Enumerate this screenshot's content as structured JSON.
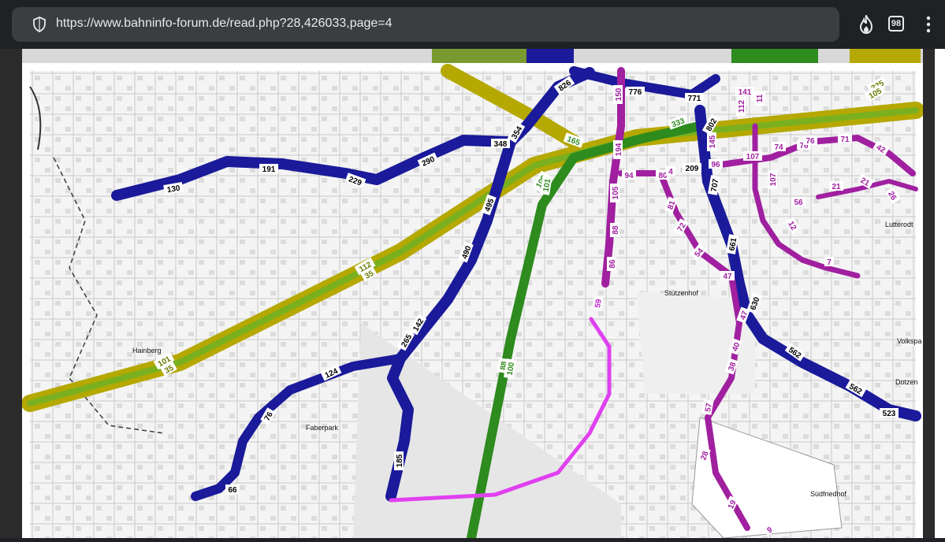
{
  "browser": {
    "url": "https://www.bahninfo-forum.de/read.php?28,426033,page=4",
    "tab_count": "98",
    "icons": [
      "shield-icon",
      "flame-icon",
      "tabs-icon",
      "more-vert-icon"
    ]
  },
  "map": {
    "colors": {
      "blue": "#1a1a9a",
      "green": "#2e8b1e",
      "olive": "#b5a800",
      "magenta": "#a020a0",
      "pink": "#e040f0"
    },
    "place_labels": [
      "Hainberg",
      "Faberpark",
      "Lutterodt",
      "Volkspa",
      "Dotzen",
      "Südfriedhof",
      "Stützenhof"
    ],
    "blue_labels": [
      "130",
      "191",
      "229",
      "290",
      "348",
      "354",
      "495",
      "490",
      "142",
      "265",
      "124",
      "76",
      "66",
      "185",
      "826",
      "776",
      "771",
      "802",
      "209",
      "707",
      "661",
      "630",
      "562",
      "562",
      "523"
    ],
    "green_labels": [
      "165",
      "109",
      "101",
      "88",
      "100",
      "333"
    ],
    "olive_labels": [
      "112",
      "35",
      "101",
      "35",
      "225",
      "105"
    ],
    "magenta_labels": [
      "150",
      "194",
      "105",
      "88",
      "86",
      "94",
      "80",
      "4",
      "96",
      "81",
      "72",
      "54",
      "47",
      "145",
      "141",
      "80",
      "112",
      "11",
      "107",
      "107",
      "76",
      "74",
      "71",
      "56",
      "21",
      "47",
      "40",
      "38",
      "57",
      "28",
      "19",
      "9",
      "76",
      "42",
      "26",
      "21",
      "12",
      "7"
    ],
    "pink_labels": [
      "59"
    ]
  }
}
